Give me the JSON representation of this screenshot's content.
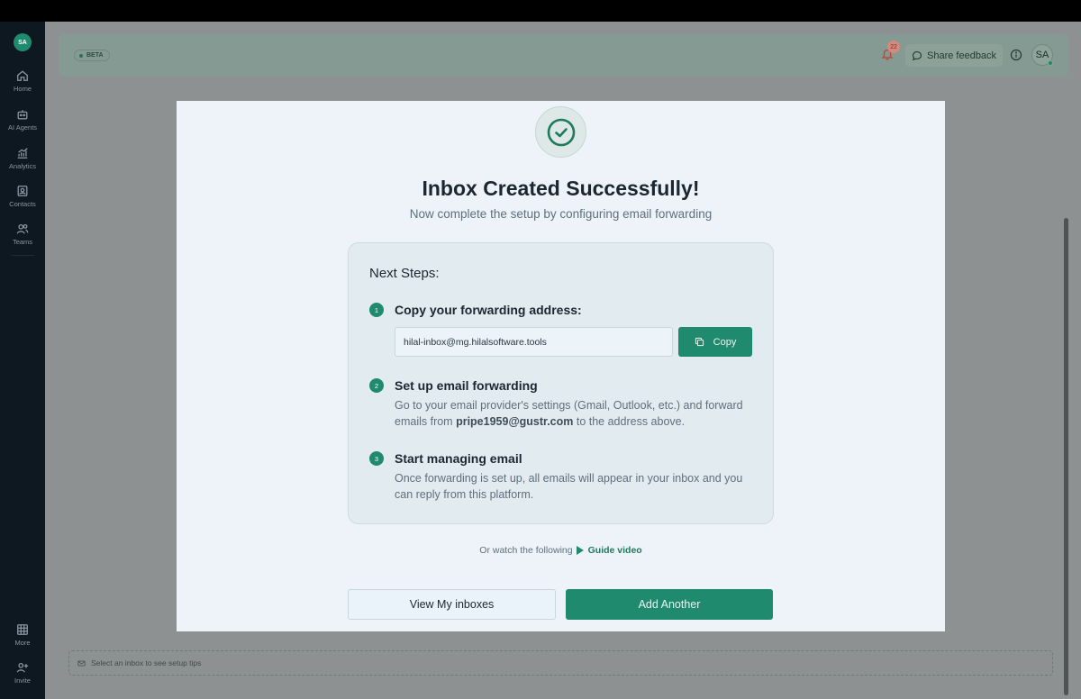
{
  "sidebar": {
    "avatar": "SA",
    "items": [
      {
        "label": "Home",
        "icon": "home-icon"
      },
      {
        "label": "AI Agents",
        "icon": "robot-icon"
      },
      {
        "label": "Analytics",
        "icon": "analytics-icon"
      },
      {
        "label": "Contacts",
        "icon": "contacts-icon"
      },
      {
        "label": "Teams",
        "icon": "teams-icon"
      }
    ],
    "bottom_items": [
      {
        "label": "More",
        "icon": "grid-icon"
      },
      {
        "label": "Invite",
        "icon": "user-plus-icon"
      }
    ]
  },
  "header": {
    "beta_label": "BETA",
    "notification_count": "22",
    "feedback_label": "Share feedback",
    "user_initials": "SA"
  },
  "modal": {
    "title": "Inbox Created Successfully!",
    "subtitle": "Now complete the setup by configuring email forwarding",
    "steps_heading": "Next Steps:",
    "steps": [
      {
        "number": "1",
        "title": "Copy your forwarding address:"
      },
      {
        "number": "2",
        "title": "Set up email forwarding",
        "desc_before": "Go to your email provider's settings (Gmail, Outlook, etc.) and forward emails from ",
        "desc_email": "pripe1959@gustr.com",
        "desc_after": " to the address above."
      },
      {
        "number": "3",
        "title": "Start managing email",
        "desc": "Once forwarding is set up, all emails will appear in your inbox and you can reply from this platform."
      }
    ],
    "forwarding_address": "hilal-inbox@mg.hilalsoftware.tools",
    "copy_label": "Copy",
    "guide_prefix": "Or watch the following",
    "guide_link": "Guide video",
    "view_inboxes_label": "View My inboxes",
    "add_another_label": "Add Another"
  },
  "tips": {
    "text": "Select an inbox to see setup tips"
  },
  "colors": {
    "accent": "#1f8a6d",
    "sidebar_bg": "#0e1821",
    "modal_bg": "#edf3f8"
  }
}
